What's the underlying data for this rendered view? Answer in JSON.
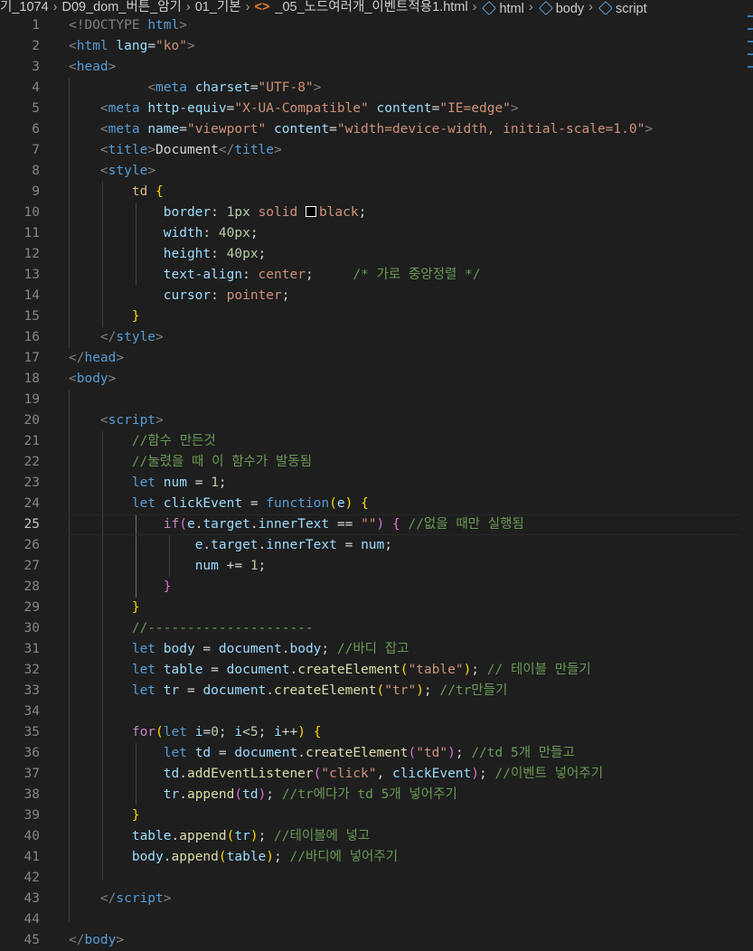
{
  "breadcrumb": {
    "items": [
      "기_1074",
      "D09_dom_버튼_암기",
      "01_기본"
    ],
    "file": "_05_노드여러개_이벤트적용1.html",
    "symbols": [
      "html",
      "body",
      "script"
    ]
  },
  "editor": {
    "active_line": 25,
    "line_numbers": [
      "1",
      "2",
      "3",
      "4",
      "5",
      "6",
      "7",
      "8",
      "9",
      "10",
      "11",
      "12",
      "13",
      "14",
      "15",
      "16",
      "17",
      "18",
      "19",
      "20",
      "21",
      "22",
      "23",
      "24",
      "25",
      "26",
      "27",
      "28",
      "29",
      "30",
      "31",
      "32",
      "33",
      "34",
      "35",
      "36",
      "37",
      "38",
      "39",
      "40",
      "41",
      "42",
      "43",
      "44",
      "45"
    ]
  },
  "code": {
    "l1": [
      "<!DOCTYPE",
      " ",
      "html",
      ">"
    ],
    "l2": [
      "<",
      "html",
      " ",
      "lang",
      "=",
      "\"ko\"",
      ">"
    ],
    "l3": [
      "<",
      "head",
      ">"
    ],
    "l4": [
      "<",
      "meta",
      " ",
      "charset",
      "=",
      "\"UTF-8\"",
      ">"
    ],
    "l5": [
      "<",
      "meta",
      " ",
      "http-equiv",
      "=",
      "\"X-UA-Compatible\"",
      " ",
      "content",
      "=",
      "\"IE=edge\"",
      ">"
    ],
    "l6": [
      "<",
      "meta",
      " ",
      "name",
      "=",
      "\"viewport\"",
      " ",
      "content",
      "=",
      "\"width=device-width, initial-scale=1.0\"",
      ">"
    ],
    "l7": [
      "<",
      "title",
      ">",
      "Document",
      "</",
      "title",
      ">"
    ],
    "l8": [
      "<",
      "style",
      ">"
    ],
    "l9": [
      "td",
      " ",
      "{"
    ],
    "l10": [
      "border",
      ": ",
      "1px",
      " ",
      "solid",
      " ",
      "black",
      ";"
    ],
    "l11": [
      "width",
      ": ",
      "40px",
      ";"
    ],
    "l12": [
      "height",
      ": ",
      "40px",
      ";"
    ],
    "l13": [
      "text-align",
      ": ",
      "center",
      ";     ",
      "/* 가로 중앙정렬 */"
    ],
    "l14": [
      "cursor",
      ": ",
      "pointer",
      ";"
    ],
    "l15": [
      "}"
    ],
    "l16": [
      "</",
      "style",
      ">"
    ],
    "l17": [
      "</",
      "head",
      ">"
    ],
    "l18": [
      "<",
      "body",
      ">"
    ],
    "l20": [
      "<",
      "script",
      ">"
    ],
    "l21": [
      "//함수 만든것"
    ],
    "l22": [
      "//눌렸을 때 이 함수가 발동됨"
    ],
    "l23": [
      "let",
      " ",
      "num",
      " = ",
      "1",
      ";"
    ],
    "l24": [
      "let",
      " ",
      "clickEvent",
      " = ",
      "function",
      "(",
      "e",
      ")",
      " ",
      "{"
    ],
    "l25": [
      "if",
      "(",
      "e",
      ".",
      "target",
      ".",
      "innerText",
      " == ",
      "\"\"",
      ")",
      " ",
      "{",
      " ",
      "//없을 때만 실행됨"
    ],
    "l26": [
      "e",
      ".",
      "target",
      ".",
      "innerText",
      " = ",
      "num",
      ";"
    ],
    "l27": [
      "num",
      " += ",
      "1",
      ";"
    ],
    "l28": [
      "}"
    ],
    "l29": [
      "}"
    ],
    "l30": [
      "//---------------------"
    ],
    "l31": [
      "let",
      " ",
      "body",
      " = ",
      "document",
      ".",
      "body",
      "; ",
      "//바디 잡고"
    ],
    "l32": [
      "let",
      " ",
      "table",
      " = ",
      "document",
      ".",
      "createElement",
      "(",
      "\"table\"",
      ")",
      "; ",
      "// 테이블 만들기"
    ],
    "l33": [
      "let",
      " ",
      "tr",
      " = ",
      "document",
      ".",
      "createElement",
      "(",
      "\"tr\"",
      ")",
      "; ",
      "//tr만들기"
    ],
    "l35": [
      "for",
      "(",
      "let",
      " ",
      "i",
      "=",
      "0",
      "; ",
      "i",
      "<",
      "5",
      "; ",
      "i",
      "++",
      ")",
      " ",
      "{"
    ],
    "l36": [
      "let",
      " ",
      "td",
      " = ",
      "document",
      ".",
      "createElement",
      "(",
      "\"td\"",
      ")",
      "; ",
      "//td 5개 만들고"
    ],
    "l37": [
      "td",
      ".",
      "addEventListener",
      "(",
      "\"click\"",
      ", ",
      "clickEvent",
      ")",
      "; ",
      "//이벤트 넣어주기"
    ],
    "l38": [
      "tr",
      ".",
      "append",
      "(",
      "td",
      ")",
      "; ",
      "//tr에다가 td 5개 넣어주기"
    ],
    "l39": [
      "}"
    ],
    "l40": [
      "table",
      ".",
      "append",
      "(",
      "tr",
      ")",
      "; ",
      "//테이블에 넣고"
    ],
    "l41": [
      "body",
      ".",
      "append",
      "(",
      "table",
      ")",
      "; ",
      "//바디에 넣어주기"
    ],
    "l43": [
      "</",
      "script",
      ">"
    ],
    "l45": [
      "</",
      "body",
      ">"
    ]
  },
  "colors": {
    "background": "#1e1e1e",
    "tag": "#569cd6",
    "attribute": "#9cdcfe",
    "string": "#ce9178",
    "comment": "#6a9955",
    "function": "#dcdcaa",
    "control": "#c586c0",
    "number": "#b5cea8"
  }
}
